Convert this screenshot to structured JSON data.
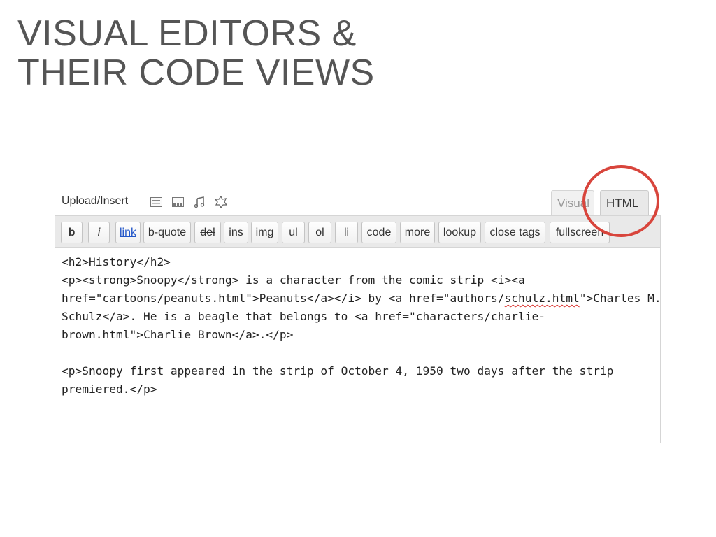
{
  "slide": {
    "title_line1": "VISUAL EDITORS &",
    "title_line2": "THEIR CODE VIEWS"
  },
  "editor": {
    "upload_label": "Upload/Insert",
    "media_icons": [
      "image-icon",
      "video-icon",
      "music-icon",
      "media-icon"
    ],
    "tabs": {
      "visual": "Visual",
      "html": "HTML"
    },
    "active_tab": "HTML",
    "toolbar_buttons": [
      "b",
      "i",
      "link",
      "b-quote",
      "del",
      "ins",
      "img",
      "ul",
      "ol",
      "li",
      "code",
      "more",
      "lookup",
      "close tags",
      "fullscreen"
    ],
    "content_lines": [
      "<h2>History</h2>",
      "<p><strong>Snoopy</strong> is a character from the comic strip <i><a",
      "href=\"cartoons/peanuts.html\">Peanuts</a></i> by <a href=\"authors/",
      "schulz.html",
      "\">Charles M.",
      "Schulz</a>. He is a beagle that belongs to <a href=\"characters/charlie-",
      "brown.html\">Charlie Brown</a>.</p>",
      "",
      "<p>Snoopy first appeared in the strip of October 4, 1950 two days after the strip",
      "premiered.</p>"
    ]
  },
  "annotation": {
    "color": "#d8453c",
    "target": "HTML"
  }
}
